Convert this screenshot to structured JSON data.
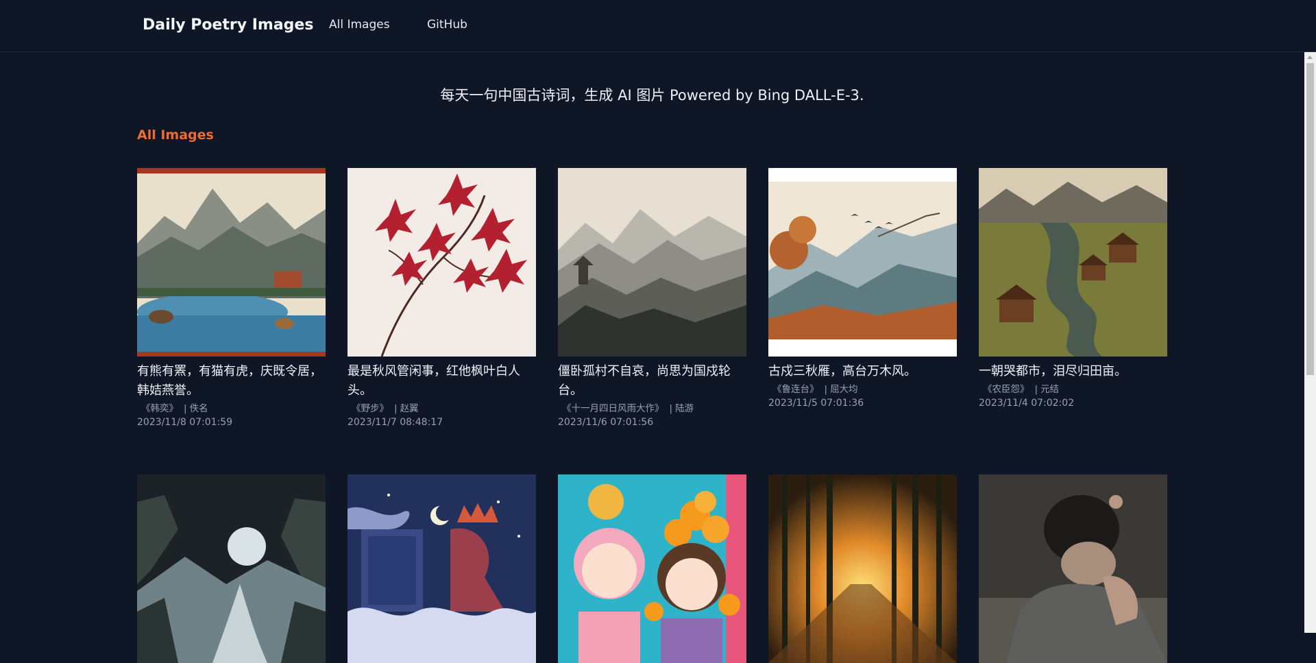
{
  "header": {
    "brand": "Daily Poetry Images",
    "nav": [
      {
        "label": "All Images"
      },
      {
        "label": "GitHub"
      }
    ]
  },
  "tagline": "每天一句中国古诗词，生成 AI 图片 Powered by Bing DALL-E-3.",
  "section_title": "All Images",
  "cards": [
    {
      "title": "有熊有罴，有猫有虎，庆既令居，韩姞燕誉。",
      "work": "《韩奕》",
      "author": "佚名",
      "date": "2023/11/8 07:01:59",
      "image": "landscape-painting-with-animals"
    },
    {
      "title": "最是秋风管闲事，红他枫叶白人头。",
      "work": "《野步》",
      "author": "赵翼",
      "date": "2023/11/7 08:48:17",
      "image": "red-maple-branch"
    },
    {
      "title": "僵卧孤村不自哀，尚思为国戍轮台。",
      "work": "《十一月四日风雨大作》",
      "author": "陆游",
      "date": "2023/11/6 07:01:56",
      "image": "misty-mountain-ink-painting"
    },
    {
      "title": "古戍三秋雁，高台万木风。",
      "work": "《鲁连台》",
      "author": "屈大均",
      "date": "2023/11/5 07:01:36",
      "image": "great-wall-autumn-geese"
    },
    {
      "title": "一朝哭都市，泪尽归田亩。",
      "work": "《农臣怨》",
      "author": "元结",
      "date": "2023/11/4 07:02:02",
      "image": "village-fields-river"
    },
    {
      "title": "",
      "work": "",
      "author": "",
      "date": "",
      "image": "snowy-valley-moon"
    },
    {
      "title": "",
      "work": "",
      "author": "",
      "date": "",
      "image": "night-sky-crown-clouds"
    },
    {
      "title": "",
      "work": "",
      "author": "",
      "date": "",
      "image": "anime-characters-peaches"
    },
    {
      "title": "",
      "work": "",
      "author": "",
      "date": "",
      "image": "bamboo-forest-sunrise"
    },
    {
      "title": "",
      "work": "",
      "author": "",
      "date": "",
      "image": "crying-man-portrait"
    }
  ],
  "colors": {
    "background": "#0f1626",
    "accent": "#f06b33",
    "meta_text": "#98a1b3"
  }
}
